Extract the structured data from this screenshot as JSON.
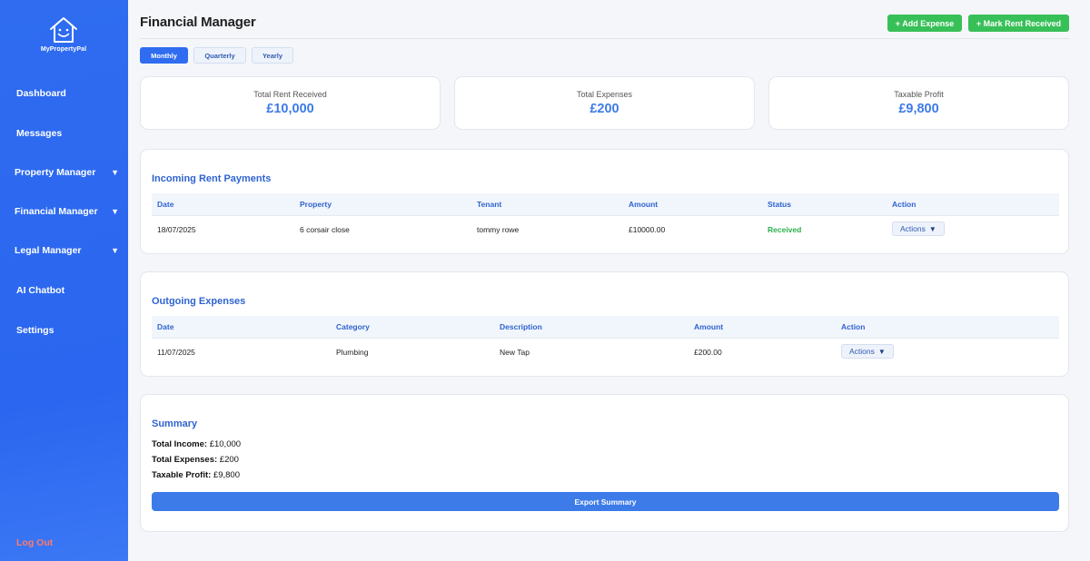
{
  "app": {
    "logo_text": "MyPropertyPal"
  },
  "sidebar": {
    "items": [
      {
        "label": "Dashboard",
        "has_arrow": false
      },
      {
        "label": "Messages",
        "has_arrow": false
      },
      {
        "label": "Property Manager",
        "has_arrow": true
      },
      {
        "label": "Financial Manager",
        "has_arrow": true
      },
      {
        "label": "Legal Manager",
        "has_arrow": true
      },
      {
        "label": "AI Chatbot",
        "has_arrow": false
      },
      {
        "label": "Settings",
        "has_arrow": false
      }
    ],
    "arrow_glyph": "▼",
    "logout_label": "Log Out"
  },
  "header": {
    "title": "Financial Manager",
    "add_expense_label": "+ Add Expense",
    "mark_rent_label": "+ Mark Rent Received"
  },
  "periods": {
    "options": [
      "Monthly",
      "Quarterly",
      "Yearly"
    ],
    "selected": "Monthly"
  },
  "stats": [
    {
      "label": "Total Rent Received",
      "value": "£10,000"
    },
    {
      "label": "Total Expenses",
      "value": "£200"
    },
    {
      "label": "Taxable Profit",
      "value": "£9,800"
    }
  ],
  "rent_payments": {
    "title": "Incoming Rent Payments",
    "columns": [
      "Date",
      "Property",
      "Tenant",
      "Amount",
      "Status",
      "Action"
    ],
    "rows": [
      {
        "date": "18/07/2025",
        "property": "6 corsair close",
        "tenant": "tommy rowe",
        "amount": "£10000.00",
        "status": "Received",
        "action": "Actions"
      }
    ]
  },
  "expenses": {
    "title": "Outgoing Expenses",
    "columns": [
      "Date",
      "Category",
      "Description",
      "Amount",
      "Action"
    ],
    "rows": [
      {
        "date": "11/07/2025",
        "category": "Plumbing",
        "description": "New Tap",
        "amount": "£200.00",
        "action": "Actions"
      }
    ]
  },
  "summary": {
    "title": "Summary",
    "income_label": "Total Income:",
    "income_value": "£10,000",
    "expenses_label": "Total Expenses:",
    "expenses_value": "£200",
    "profit_label": "Taxable Profit:",
    "profit_value": "£9,800",
    "export_label": "Export Summary"
  },
  "colors": {
    "sidebar": "#2f6cf0",
    "accent": "#3d7be8",
    "success": "#38c058",
    "logout": "#ff7a6a"
  }
}
